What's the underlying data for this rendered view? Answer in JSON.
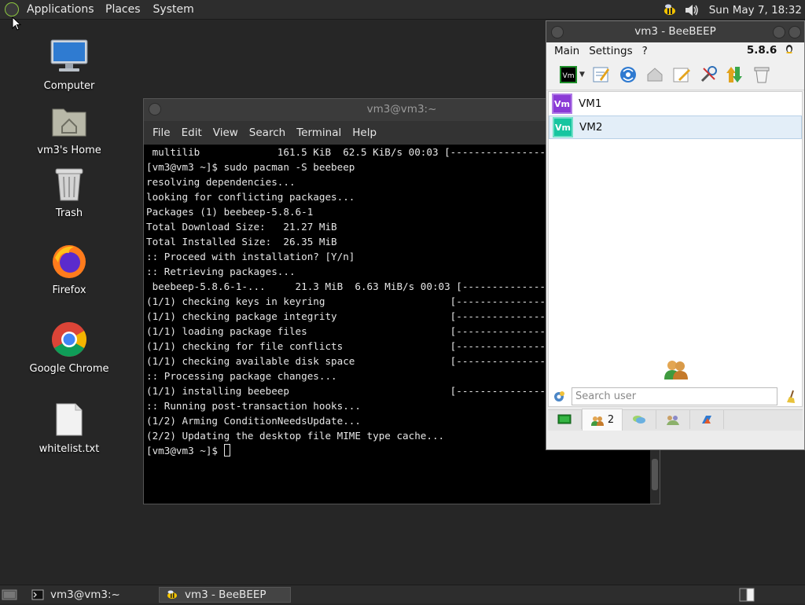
{
  "top_panel": {
    "menus": [
      "Applications",
      "Places",
      "System"
    ],
    "clock": "Sun May 7, 18:32"
  },
  "desktop": {
    "icons": [
      {
        "label": "Computer",
        "icon": "computer-icon"
      },
      {
        "label": "vm3's Home",
        "icon": "home-folder-icon"
      },
      {
        "label": "Trash",
        "icon": "trash-icon"
      },
      {
        "label": "Firefox",
        "icon": "firefox-icon"
      },
      {
        "label": "Google Chrome",
        "icon": "chrome-icon"
      },
      {
        "label": "whitelist.txt",
        "icon": "text-file-icon"
      }
    ]
  },
  "terminal": {
    "title": "vm3@vm3:~",
    "menu": [
      "File",
      "Edit",
      "View",
      "Search",
      "Terminal",
      "Help"
    ],
    "lines": [
      " multilib             161.5 KiB  62.5 KiB/s 00:03 [----------------------",
      "[vm3@vm3 ~]$ sudo pacman -S beebeep",
      "resolving dependencies...",
      "looking for conflicting packages...",
      "",
      "Packages (1) beebeep-5.8.6-1",
      "",
      "Total Download Size:   21.27 MiB",
      "Total Installed Size:  26.35 MiB",
      "",
      ":: Proceed with installation? [Y/n]",
      ":: Retrieving packages...",
      " beebeep-5.8.6-1-...     21.3 MiB  6.63 MiB/s 00:03 [----------------------",
      "(1/1) checking keys in keyring                     [----------------------",
      "(1/1) checking package integrity                   [----------------------",
      "(1/1) loading package files                        [----------------------",
      "(1/1) checking for file conflicts                  [----------------------",
      "(1/1) checking available disk space                [----------------------",
      ":: Processing package changes...",
      "(1/1) installing beebeep                           [----------------------",
      ":: Running post-transaction hooks...",
      "(1/2) Arming ConditionNeedsUpdate...",
      "(2/2) Updating the desktop file MIME type cache..."
    ],
    "prompt": "[vm3@vm3 ~]$ "
  },
  "beebeep": {
    "title": "vm3 - BeeBEEP",
    "menu": [
      "Main",
      "Settings",
      "?"
    ],
    "version": "5.8.6",
    "users": [
      {
        "badge": "Vm",
        "name": "VM1",
        "color": "#8a3ad6"
      },
      {
        "badge": "Vm",
        "name": "VM2",
        "color": "#17c5a0"
      }
    ],
    "search_placeholder": "Search user",
    "tab_count": "2"
  },
  "taskbar": {
    "tasks": [
      "vm3@vm3:~",
      "vm3 - BeeBEEP"
    ]
  }
}
